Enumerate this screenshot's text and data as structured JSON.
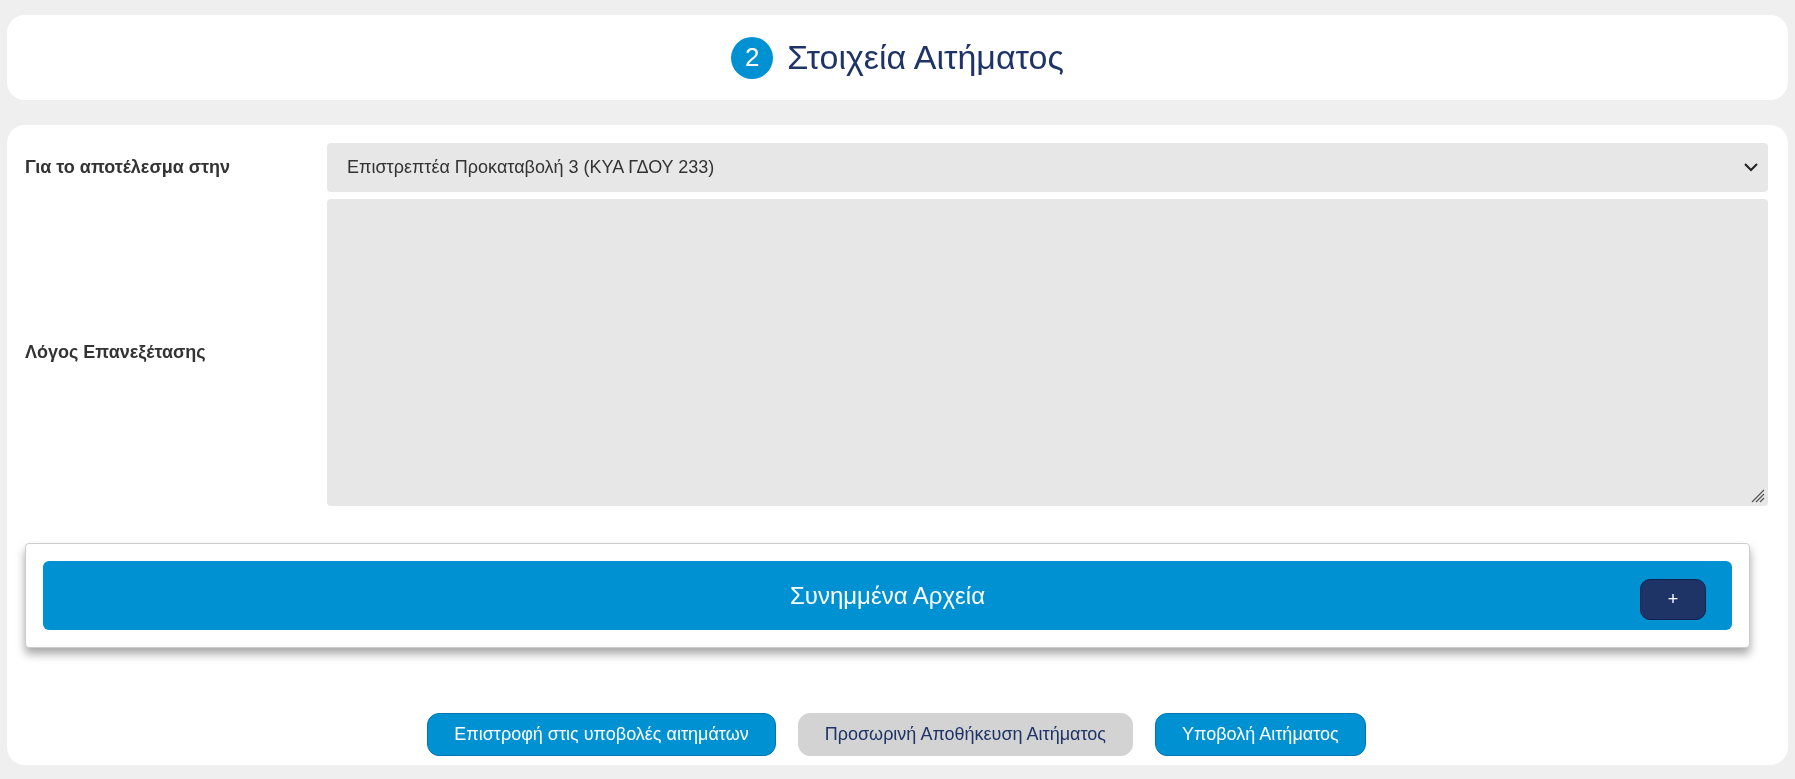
{
  "header": {
    "step": "2",
    "title": "Στοιχεία Αιτήματος"
  },
  "form": {
    "fields": [
      {
        "kind": "select",
        "label": "Για το αποτέλεσμα στην",
        "value": "Επιστρεπτέα Προκαταβολή 3 (ΚΥΑ ΓΔΟΥ 233)"
      },
      {
        "kind": "textarea",
        "label": "Λόγος Επανεξέτασης"
      }
    ]
  },
  "attachments": {
    "title": "Συνημμένα Αρχεία",
    "add_button": "+"
  },
  "buttons": [
    {
      "label": "Επιστροφή στις υποβολές αιτημάτων",
      "kind": "primary"
    },
    {
      "label": "Προσωρινή Αποθήκευση Αιτήματος",
      "kind": "secondary"
    },
    {
      "label": "Υποβολή Αιτήματος",
      "kind": "primary"
    }
  ]
}
